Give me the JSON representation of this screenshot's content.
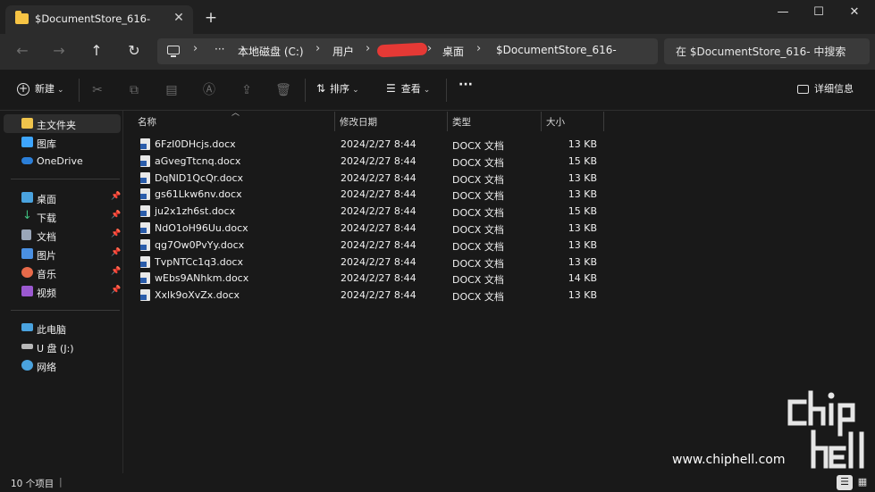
{
  "window": {
    "tab_title": "$DocumentStore_616-",
    "tab_close": "✕",
    "new_tab": "+",
    "minimize": "—",
    "maximize": "☐",
    "close": "✕"
  },
  "navigation": {
    "back": "←",
    "forward": "→",
    "up": "↑",
    "refresh": "↻"
  },
  "address": {
    "overflow": "···",
    "breadcrumbs": [
      "本地磁盘 (C:)",
      "用户",
      "",
      "桌面",
      "$DocumentStore_616-"
    ],
    "separator": "›"
  },
  "search": {
    "placeholder": "在 $DocumentStore_616- 中搜索"
  },
  "toolbar": {
    "new_label": "新建",
    "sort_label": "排序",
    "view_label": "查看",
    "more_label": "···",
    "details_label": "详细信息"
  },
  "sidebar": {
    "items": [
      {
        "label": "主文件夹",
        "icon": "home-icon",
        "color": "#f0c44c"
      },
      {
        "label": "图库",
        "icon": "gallery-icon",
        "color": "#3ea6ff"
      },
      {
        "label": "OneDrive",
        "icon": "cloud-icon",
        "color": "#2b7fd8"
      },
      {
        "label": "桌面",
        "icon": "desktop-icon",
        "color": "#4aa3df"
      },
      {
        "label": "下载",
        "icon": "download-icon",
        "color": "#3fbf7f"
      },
      {
        "label": "文档",
        "icon": "document-icon",
        "color": "#9aa6b8"
      },
      {
        "label": "图片",
        "icon": "pictures-icon",
        "color": "#4a90e2"
      },
      {
        "label": "音乐",
        "icon": "music-icon",
        "color": "#e86a4a"
      },
      {
        "label": "视频",
        "icon": "video-icon",
        "color": "#9b59d0"
      },
      {
        "label": "此电脑",
        "icon": "computer-icon",
        "color": "#4aa3df"
      },
      {
        "label": "U 盘 (J:)",
        "icon": "usb-drive-icon",
        "color": "#b8b8b8"
      },
      {
        "label": "网络",
        "icon": "network-icon",
        "color": "#4aa3df"
      }
    ]
  },
  "columns": {
    "name": "名称",
    "modified": "修改日期",
    "type": "类型",
    "size": "大小"
  },
  "files": [
    {
      "name": "6FzI0DHcjs.docx",
      "modified": "2024/2/27 8:44",
      "type": "DOCX 文档",
      "size": "13 KB"
    },
    {
      "name": "aGvegTtcnq.docx",
      "modified": "2024/2/27 8:44",
      "type": "DOCX 文档",
      "size": "15 KB"
    },
    {
      "name": "DqNID1QcQr.docx",
      "modified": "2024/2/27 8:44",
      "type": "DOCX 文档",
      "size": "13 KB"
    },
    {
      "name": "gs61Lkw6nv.docx",
      "modified": "2024/2/27 8:44",
      "type": "DOCX 文档",
      "size": "13 KB"
    },
    {
      "name": "ju2x1zh6st.docx",
      "modified": "2024/2/27 8:44",
      "type": "DOCX 文档",
      "size": "15 KB"
    },
    {
      "name": "NdO1oH96Uu.docx",
      "modified": "2024/2/27 8:44",
      "type": "DOCX 文档",
      "size": "13 KB"
    },
    {
      "name": "qg7Ow0PvYy.docx",
      "modified": "2024/2/27 8:44",
      "type": "DOCX 文档",
      "size": "13 KB"
    },
    {
      "name": "TvpNTCc1q3.docx",
      "modified": "2024/2/27 8:44",
      "type": "DOCX 文档",
      "size": "13 KB"
    },
    {
      "name": "wEbs9ANhkm.docx",
      "modified": "2024/2/27 8:44",
      "type": "DOCX 文档",
      "size": "14 KB"
    },
    {
      "name": "Xxlk9oXvZx.docx",
      "modified": "2024/2/27 8:44",
      "type": "DOCX 文档",
      "size": "13 KB"
    }
  ],
  "status": {
    "item_count": "10 个项目"
  },
  "watermark": {
    "url": "www.chiphell.com",
    "logo_text": "chip hell"
  }
}
